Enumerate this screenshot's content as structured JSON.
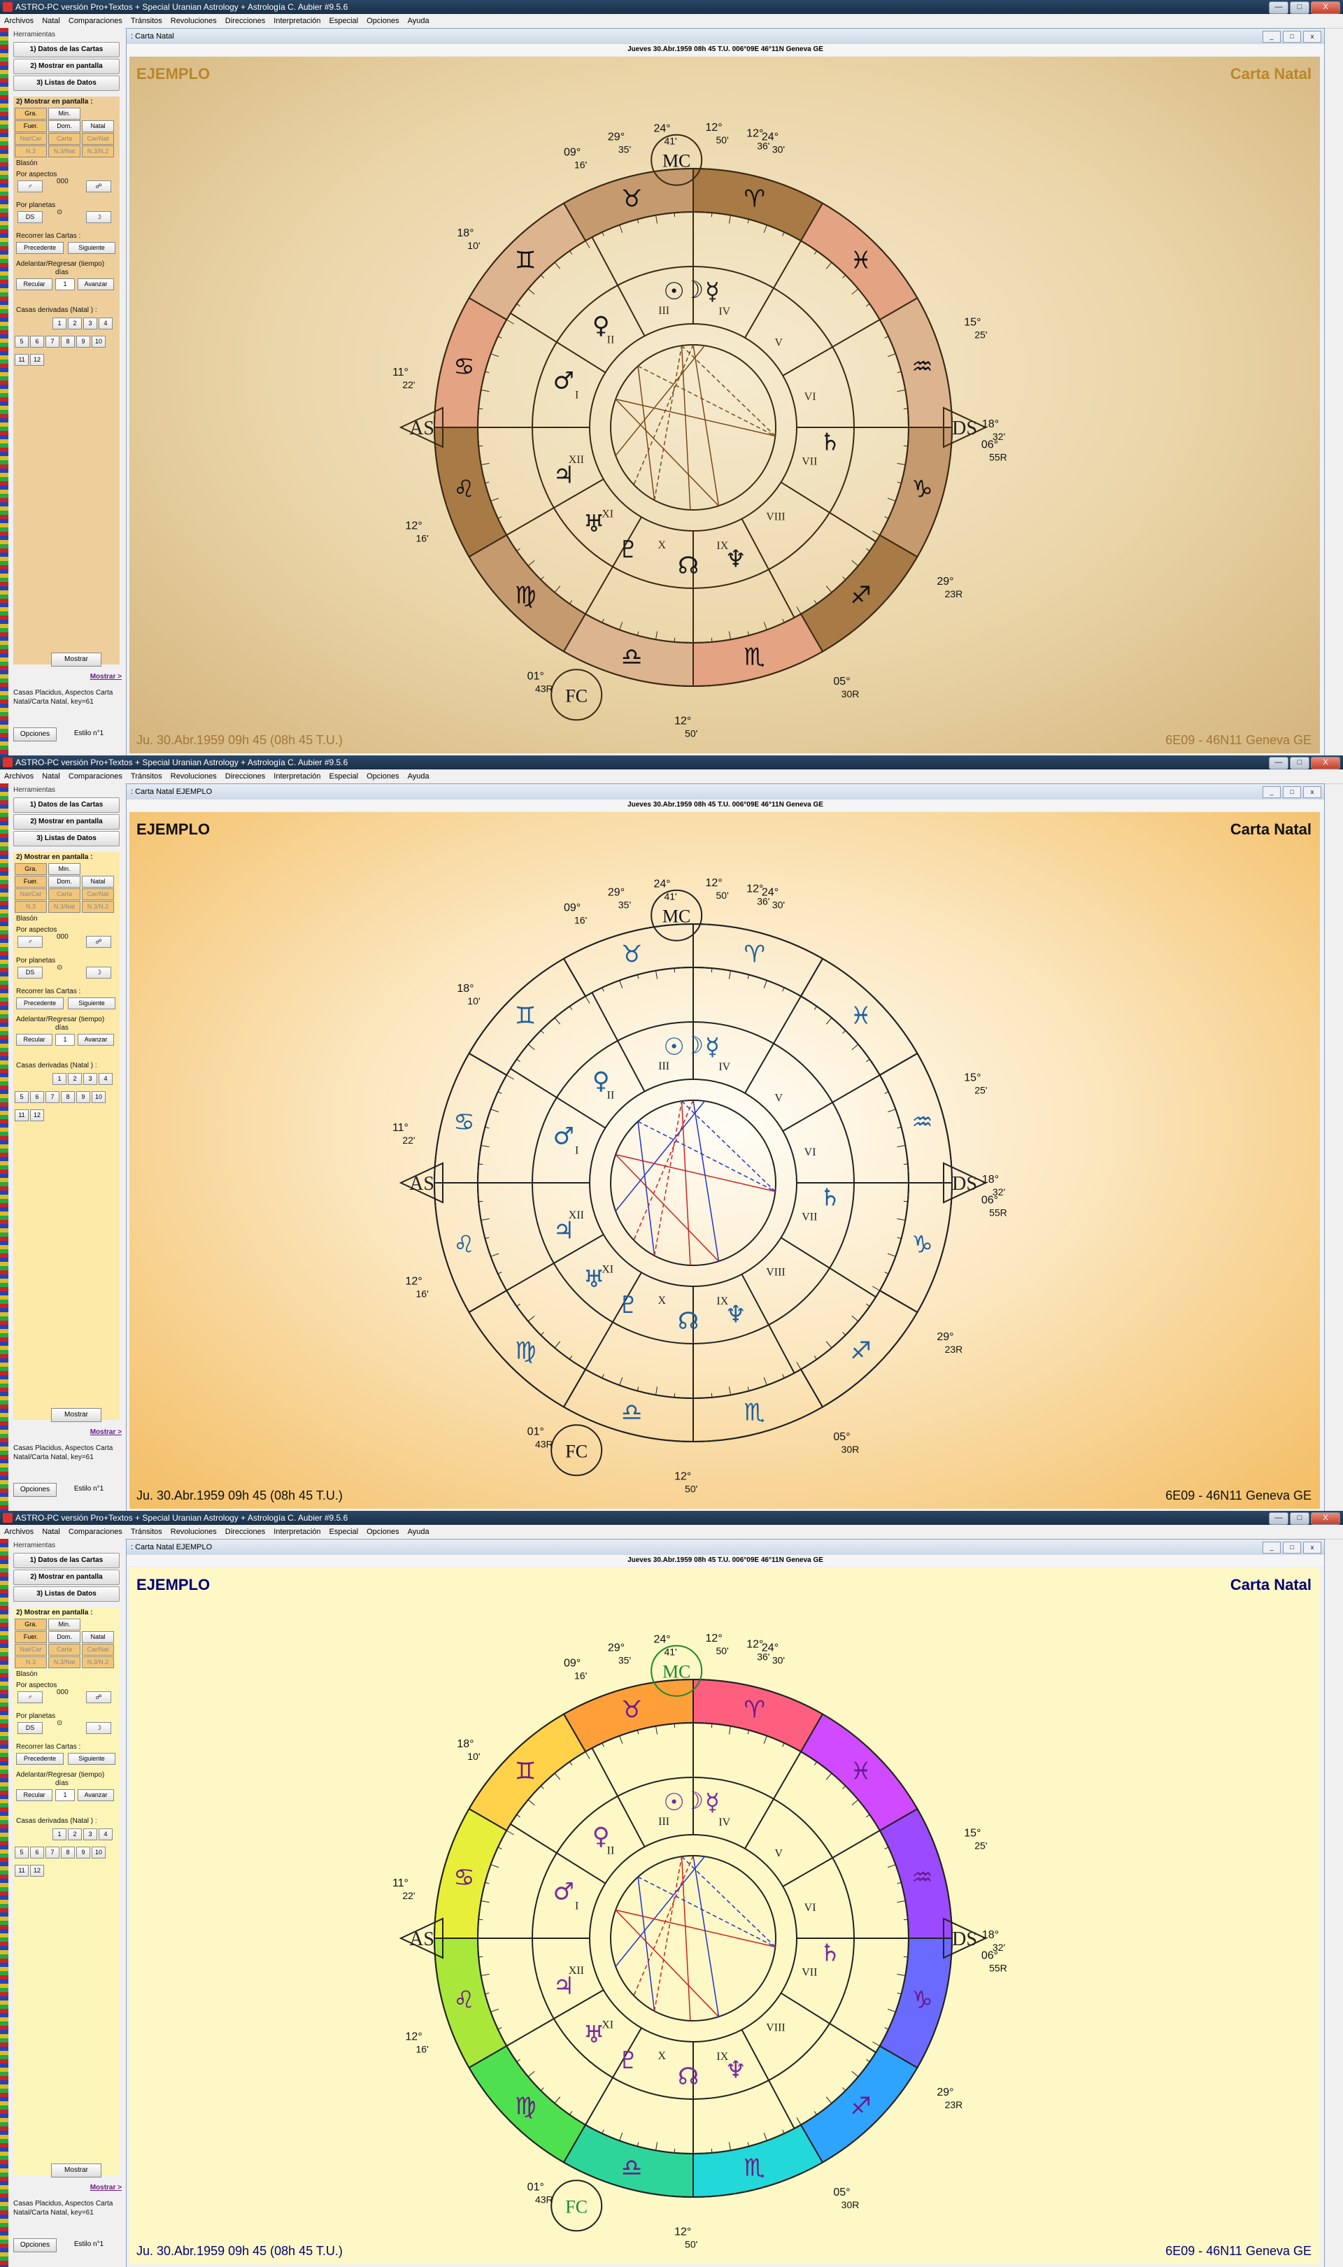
{
  "window": {
    "title": "ASTRO-PC versión Pro+Textos + Special Uranian Astrology + Astrología C. Aubier #9.5.6",
    "controls": [
      "—",
      "□",
      "X"
    ]
  },
  "menu": [
    "Archivos",
    "Natal",
    "Comparaciones",
    "Tránsitos",
    "Revoluciones",
    "Direcciones",
    "Interpretación",
    "Especial",
    "Opciones",
    "Ayuda"
  ],
  "sidebar": {
    "header": "Herramientas",
    "btn_datos": "1) Datos de las Cartas",
    "btn_mostrar": "2) Mostrar en pantalla",
    "btn_listas": "3) Listas de Datos",
    "panel_title": "2) Mostrar en pantalla :",
    "grid1": [
      "Gra.",
      "Min.",
      ""
    ],
    "grid2": [
      "Fuer.",
      "Dom.",
      "Natal"
    ],
    "grid3": [
      "Nat/Car",
      "Carta",
      "Car/Nat"
    ],
    "grid4": [
      "N.3",
      "N.3/Nat",
      "N.3/N.2"
    ],
    "blason": "Blasón",
    "por_aspectos": "Por aspectos",
    "aspect_values": [
      "♂",
      "000",
      "☍"
    ],
    "por_planetas": "Por planetas",
    "planet_values": [
      "DS",
      "⊙",
      "☽"
    ],
    "recorrer": "Recorrer las Cartas :",
    "precedente": "Precedente",
    "siguiente": "Siguiente",
    "adelantar": "Adelantar/Regresar (tiempo)",
    "dias": "días",
    "recular": "Recular",
    "days_value": "1",
    "avanzar": "Avanzar",
    "casas": "Casas derivadas (Natal ) :",
    "houses": [
      "1",
      "2",
      "3",
      "4",
      "5",
      "6",
      "7",
      "8",
      "9",
      "10",
      "11",
      "12"
    ],
    "mostrar_btn": "Mostrar",
    "mostrar_link": "Mostrar >",
    "note": "Casas Placidus, Aspectos Carta Natal/Carta Natal, key=61",
    "opciones": "Opciones",
    "estilo": "Estilo n°1"
  },
  "child_window": {
    "title": ": Carta Natal",
    "title_with_name": ": Carta Natal  EJEMPLO",
    "info": "Jueves 30.Abr.1959 08h 45 T.U. 006°09E 46°11N  Geneva GE"
  },
  "chart": {
    "name": "EJEMPLO",
    "type": "Carta Natal",
    "date_footer": "Ju. 30.Abr.1959 09h 45 (08h 45 T.U.)",
    "place_footer": "6E09 - 46N11  Geneva GE",
    "houses_roman": [
      "I",
      "II",
      "III",
      "IV",
      "V",
      "VI",
      "VII",
      "VIII",
      "IX",
      "X",
      "XI",
      "XII"
    ],
    "angles": {
      "asc": "AS",
      "dsc": "DS",
      "mc": "MC",
      "ic": "FC"
    },
    "degree_labels": [
      {
        "deg": "29°",
        "min": "35'"
      },
      {
        "deg": "24°",
        "min": "41'"
      },
      {
        "deg": "12°",
        "min": "50'"
      },
      {
        "deg": "12°",
        "min": "36'"
      },
      {
        "deg": "09°",
        "min": "16'"
      },
      {
        "deg": "18°",
        "min": "10'"
      },
      {
        "deg": "11°",
        "min": "22'"
      },
      {
        "deg": "12°",
        "min": "16'"
      },
      {
        "deg": "01°",
        "min": "43R"
      },
      {
        "deg": "12°",
        "min": "50'"
      },
      {
        "deg": "05°",
        "min": "30R"
      },
      {
        "deg": "29°",
        "min": "23R"
      },
      {
        "deg": "06°",
        "min": "55R"
      },
      {
        "deg": "15°",
        "min": "25'"
      },
      {
        "deg": "24°",
        "min": "30'"
      },
      {
        "deg": "18°",
        "min": "32'"
      }
    ],
    "zodiac": [
      "♈",
      "♉",
      "♊",
      "♋",
      "♌",
      "♍",
      "♎",
      "♏",
      "♐",
      "♑",
      "♒",
      "♓"
    ],
    "planets": [
      "☉",
      "☽",
      "☿",
      "♀",
      "♂",
      "♃",
      "♄",
      "♅",
      "♆",
      "♇",
      "☊"
    ]
  },
  "panes": [
    {
      "style": "parchment",
      "accent": "#8a6a3c",
      "name_color": "#b9862b",
      "text_color": "#a3783a"
    },
    {
      "style": "classic",
      "accent": "#222222",
      "name_color": "#111111",
      "text_color": "#111111"
    },
    {
      "style": "rainbow",
      "accent": "#000080",
      "name_color": "#00007a",
      "text_color": "#00007a"
    }
  ]
}
